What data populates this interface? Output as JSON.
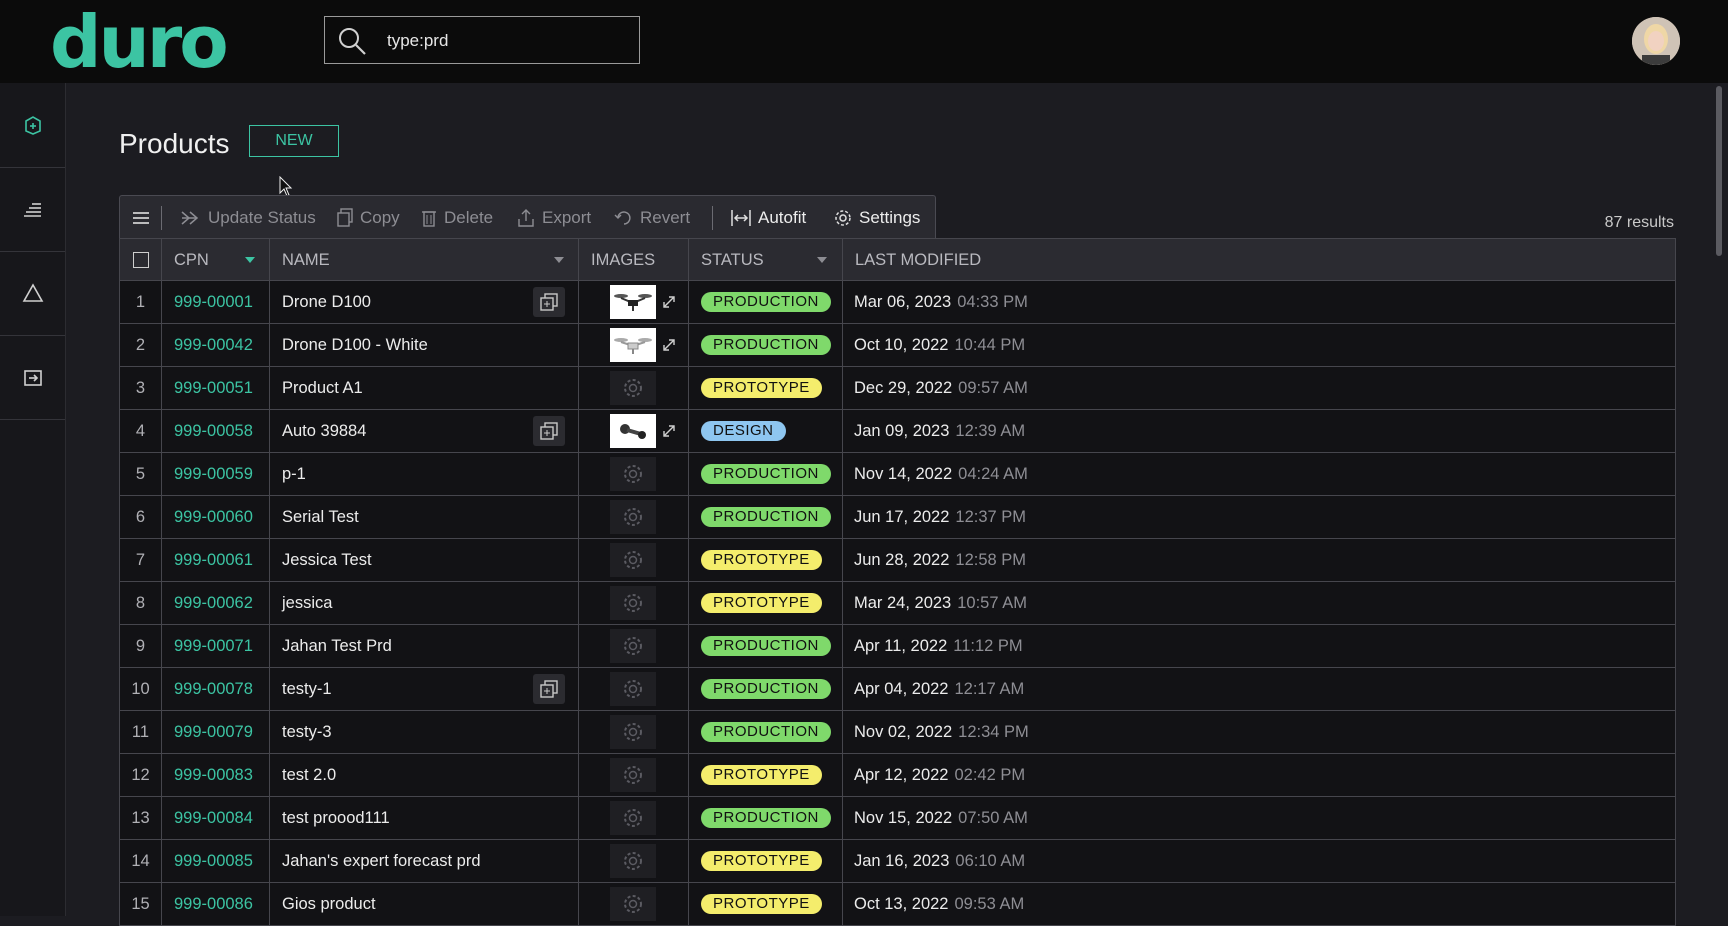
{
  "app": {
    "logo": "duro"
  },
  "search": {
    "value": "type:prd"
  },
  "page": {
    "title": "Products",
    "new_label": "NEW"
  },
  "toolbar": {
    "items": [
      {
        "label": "Update Status",
        "icon": "double-chevron-right-icon",
        "enabled": false
      },
      {
        "label": "Copy",
        "icon": "copy-icon",
        "enabled": false
      },
      {
        "label": "Delete",
        "icon": "trash-icon",
        "enabled": false
      },
      {
        "label": "Export",
        "icon": "export-icon",
        "enabled": false
      },
      {
        "label": "Revert",
        "icon": "revert-icon",
        "enabled": false
      },
      {
        "label": "Autofit",
        "icon": "autofit-icon",
        "enabled": true
      },
      {
        "label": "Settings",
        "icon": "gear-icon",
        "enabled": true
      }
    ],
    "results": "87 results"
  },
  "table": {
    "headers": {
      "cpn": "CPN",
      "name": "NAME",
      "images": "IMAGES",
      "status": "STATUS",
      "last_modified": "LAST MODIFIED"
    },
    "rows": [
      {
        "n": "1",
        "cpn": "999-00001",
        "name": "Drone D100",
        "dup": true,
        "image": "drone",
        "status": "PRODUCTION",
        "date": "Mar 06, 2023",
        "time": "04:33 PM"
      },
      {
        "n": "2",
        "cpn": "999-00042",
        "name": "Drone D100 - White",
        "dup": false,
        "image": "drone-white",
        "status": "PRODUCTION",
        "date": "Oct 10, 2022",
        "time": "10:44 PM"
      },
      {
        "n": "3",
        "cpn": "999-00051",
        "name": "Product A1",
        "dup": false,
        "image": "",
        "status": "PROTOTYPE",
        "date": "Dec 29, 2022",
        "time": "09:57 AM"
      },
      {
        "n": "4",
        "cpn": "999-00058",
        "name": "Auto 39884",
        "dup": true,
        "image": "part",
        "status": "DESIGN",
        "date": "Jan 09, 2023",
        "time": "12:39 AM"
      },
      {
        "n": "5",
        "cpn": "999-00059",
        "name": "p-1",
        "dup": false,
        "image": "",
        "status": "PRODUCTION",
        "date": "Nov 14, 2022",
        "time": "04:24 AM"
      },
      {
        "n": "6",
        "cpn": "999-00060",
        "name": "Serial Test",
        "dup": false,
        "image": "",
        "status": "PRODUCTION",
        "date": "Jun 17, 2022",
        "time": "12:37 PM"
      },
      {
        "n": "7",
        "cpn": "999-00061",
        "name": "Jessica Test",
        "dup": false,
        "image": "",
        "status": "PROTOTYPE",
        "date": "Jun 28, 2022",
        "time": "12:58 PM"
      },
      {
        "n": "8",
        "cpn": "999-00062",
        "name": "jessica",
        "dup": false,
        "image": "",
        "status": "PROTOTYPE",
        "date": "Mar 24, 2023",
        "time": "10:57 AM"
      },
      {
        "n": "9",
        "cpn": "999-00071",
        "name": "Jahan Test Prd",
        "dup": false,
        "image": "",
        "status": "PRODUCTION",
        "date": "Apr 11, 2022",
        "time": "11:12 PM"
      },
      {
        "n": "10",
        "cpn": "999-00078",
        "name": "testy-1",
        "dup": true,
        "image": "",
        "status": "PRODUCTION",
        "date": "Apr 04, 2022",
        "time": "12:17 AM"
      },
      {
        "n": "11",
        "cpn": "999-00079",
        "name": "testy-3",
        "dup": false,
        "image": "",
        "status": "PRODUCTION",
        "date": "Nov 02, 2022",
        "time": "12:34 PM"
      },
      {
        "n": "12",
        "cpn": "999-00083",
        "name": "test 2.0",
        "dup": false,
        "image": "",
        "status": "PROTOTYPE",
        "date": "Apr 12, 2022",
        "time": "02:42 PM"
      },
      {
        "n": "13",
        "cpn": "999-00084",
        "name": "test proood111",
        "dup": false,
        "image": "",
        "status": "PRODUCTION",
        "date": "Nov 15, 2022",
        "time": "07:50 AM"
      },
      {
        "n": "14",
        "cpn": "999-00085",
        "name": "Jahan's expert forecast prd",
        "dup": false,
        "image": "",
        "status": "PROTOTYPE",
        "date": "Jan 16, 2023",
        "time": "06:10 AM"
      },
      {
        "n": "15",
        "cpn": "999-00086",
        "name": "Gios product",
        "dup": false,
        "image": "",
        "status": "PROTOTYPE",
        "date": "Oct 13, 2022",
        "time": "09:53 AM"
      }
    ]
  },
  "colors": {
    "accent": "#3cc4a3",
    "production": "#7fd96b",
    "prototype": "#f4ed6c",
    "design": "#8ec6f0"
  }
}
